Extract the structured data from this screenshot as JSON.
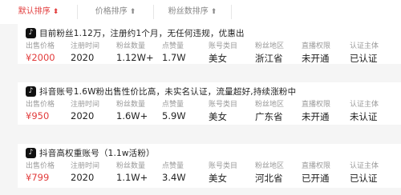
{
  "sort_bar": {
    "items": [
      {
        "label": "默认排序",
        "arrow": "⬍",
        "active": true
      },
      {
        "label": "价格排序",
        "arrow": "⬆",
        "active": false
      },
      {
        "label": "粉丝数排序",
        "arrow": "⬆",
        "active": false
      }
    ]
  },
  "columns": [
    "出售价格",
    "注册时间",
    "粉丝数量",
    "点赞量",
    "账号类目",
    "粉丝地区",
    "直播权限",
    "认证主体"
  ],
  "listings": [
    {
      "title": "目前粉丝1.12万，注册约1个月，无任何违规，优惠出",
      "values": [
        "¥2000",
        "2020",
        "1.12W+",
        "1.7W",
        "美女",
        "浙江省",
        "未开通",
        "已认证"
      ]
    },
    {
      "title": "抖音账号1.6W粉出售性价比高，未实名认证，流量超好,持续涨粉中",
      "values": [
        "¥950",
        "2020",
        "1.6W+",
        "5.9W",
        "美女",
        "广东省",
        "未开通",
        "未认证"
      ]
    },
    {
      "title": "抖音高权重账号（1.1w活粉）",
      "values": [
        "¥799",
        "2020",
        "1.1W+",
        "3.4W",
        "美女",
        "河北省",
        "已开通",
        "已认证"
      ]
    }
  ]
}
